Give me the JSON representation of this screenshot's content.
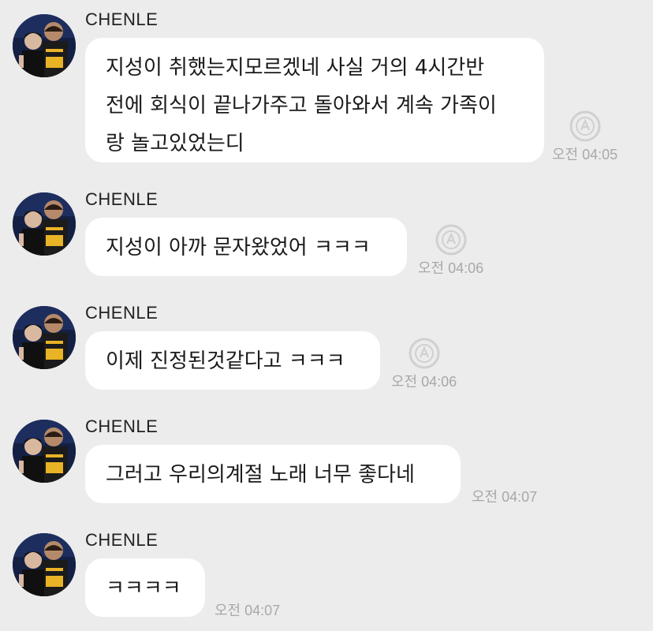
{
  "messages": [
    {
      "sender": "CHENLE",
      "text": "지성이 취했는지모르겠네 사실 거의 4시간반\n전에 회식이 끝나가주고 돌아와서 계속 가족이\n랑 놀고있었는디",
      "time": "오전 04:05",
      "translate_icon": "translate-icon"
    },
    {
      "sender": "CHENLE",
      "text": "지성이 아까 문자왔었어 ㅋㅋㅋ",
      "time": "오전 04:06",
      "translate_icon": "translate-icon"
    },
    {
      "sender": "CHENLE",
      "text": "이제 진정된것같다고 ㅋㅋㅋ",
      "time": "오전 04:06",
      "translate_icon": "translate-icon"
    },
    {
      "sender": "CHENLE",
      "text": "그러고 우리의계절 노래 너무 좋다네",
      "time": "오전 04:07"
    },
    {
      "sender": "CHENLE",
      "text": "ㅋㅋㅋㅋ",
      "time": "오전 04:07"
    }
  ],
  "colors": {
    "background": "#ececec",
    "bubble": "#ffffff",
    "time": "#a8a8a8"
  }
}
